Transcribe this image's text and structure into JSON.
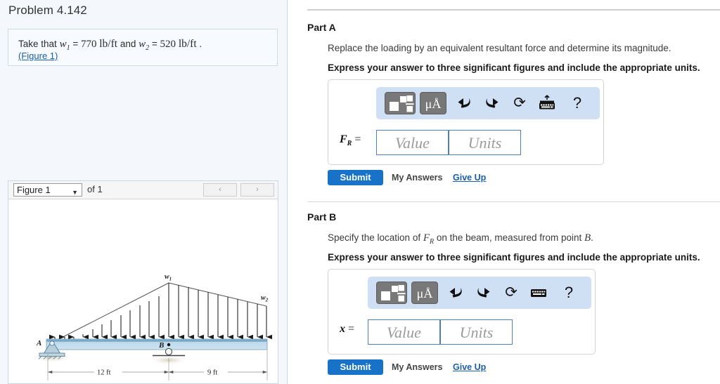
{
  "problem": {
    "title": "Problem 4.142",
    "statement_prefix": "Take that",
    "w1_symbol": "w",
    "w1_sub": "1",
    "w1_value": "770",
    "w1_units": "lb/ft",
    "conjunction": "and",
    "w2_symbol": "w",
    "w2_sub": "2",
    "w2_value": "520",
    "w2_units": "lb/ft",
    "period": ".",
    "figure_link": "(Figure 1)"
  },
  "figure_panel": {
    "selected_figure": "Figure 1",
    "of_label": "of 1",
    "prev_icon": "‹",
    "next_icon": "›",
    "caret_icon": "▼"
  },
  "figure": {
    "label_A": "A",
    "label_B": "B",
    "label_w1": "w",
    "label_w1_sub": "1",
    "label_w2": "w",
    "label_w2_sub": "2",
    "dim_left": "12 ft",
    "dim_right": "9 ft",
    "beam_color": "#a8cbe0",
    "beam_top_color": "#5b8fb0"
  },
  "parts": [
    {
      "heading": "Part A",
      "prompt_before": "Replace the loading by an equivalent resultant force and determine its magnitude.",
      "instruction": "Express your answer to three significant figures and include the appropriate units.",
      "answer_label": "F",
      "answer_label_sub": "R",
      "answer_equals": "=",
      "value_placeholder": "Value",
      "units_placeholder": "Units",
      "value_current": "",
      "units_current": "",
      "submit_label": "Submit",
      "my_answers_label": "My Answers",
      "give_up_label": "Give Up",
      "toolbar": {
        "template_icon": "math-template-icon",
        "units_icon": "μÅ",
        "undo_icon": "⮪",
        "redo_icon": "⮫",
        "reset_icon": "⟳",
        "keyboard_icon": "keyboard-icon",
        "help_icon": "?"
      }
    },
    {
      "heading": "Part B",
      "prompt_segments": [
        "Specify the location of ",
        "F",
        "R",
        " on the beam, measured from point ",
        "B",
        "."
      ],
      "instruction": "Express your answer to three significant figures and include the appropriate units.",
      "answer_label": "x",
      "answer_label_sub": "",
      "answer_equals": "=",
      "value_placeholder": "Value",
      "units_placeholder": "Units",
      "value_current": "",
      "units_current": "",
      "submit_label": "Submit",
      "my_answers_label": "My Answers",
      "give_up_label": "Give Up",
      "toolbar": {
        "template_icon": "math-template-icon",
        "units_icon": "μÅ",
        "undo_icon": "⮪",
        "redo_icon": "⮫",
        "reset_icon": "⟳",
        "keyboard_icon": "keyboard-icon",
        "help_icon": "?"
      }
    }
  ],
  "colors": {
    "accent_blue": "#1873c8",
    "link_blue": "#1a5fa8",
    "toolbar_blue": "#cfe0f5",
    "panel_bg": "#f4f8fc"
  }
}
